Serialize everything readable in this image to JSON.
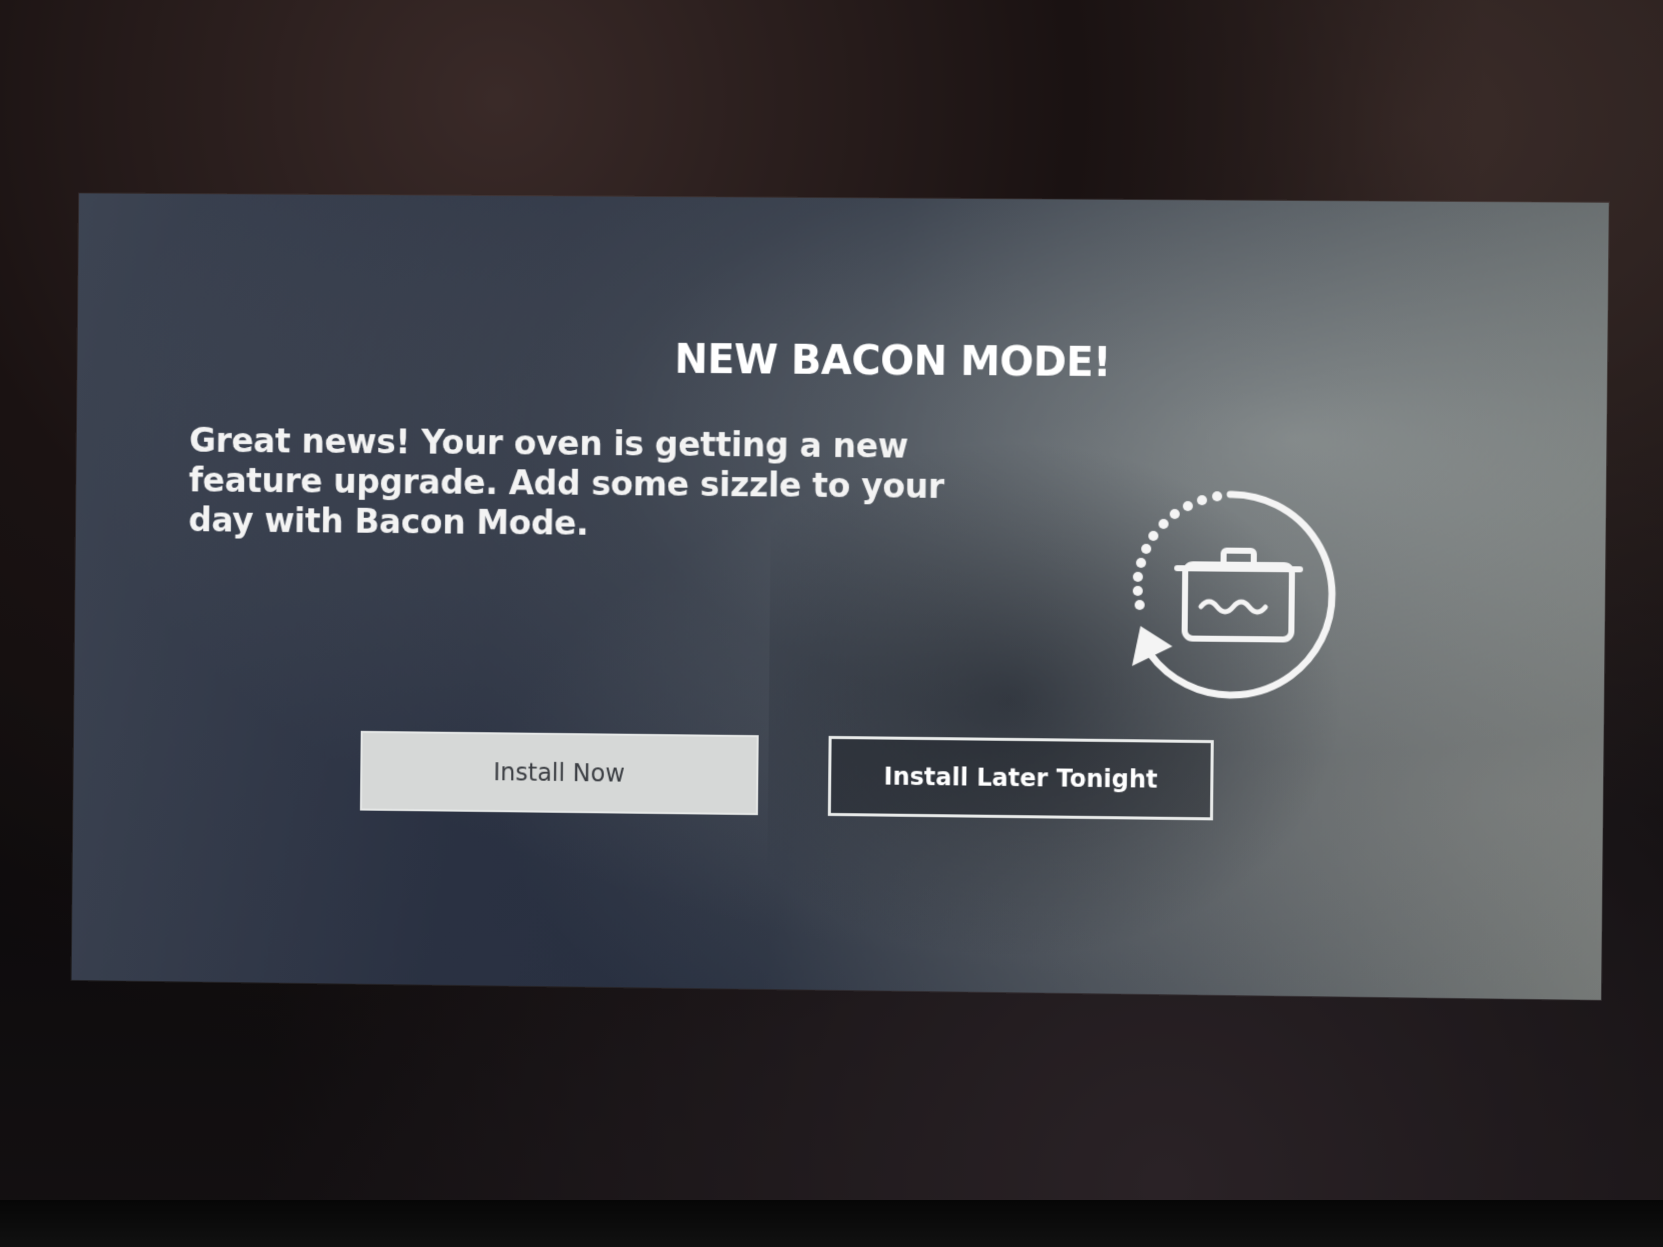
{
  "dialog": {
    "title": "NEW BACON MODE!",
    "message": "Great news! Your oven is getting a new feature upgrade. Add some sizzle to your day with Bacon Mode.",
    "icon": "pot-update-icon"
  },
  "buttons": {
    "install_now": "Install Now",
    "install_later": "Install Later Tonight"
  },
  "colors": {
    "screen_bg": "#2a3142",
    "text": "#ffffff",
    "primary_button_bg": "#d6d8d7",
    "primary_button_text": "#3a3d42"
  }
}
